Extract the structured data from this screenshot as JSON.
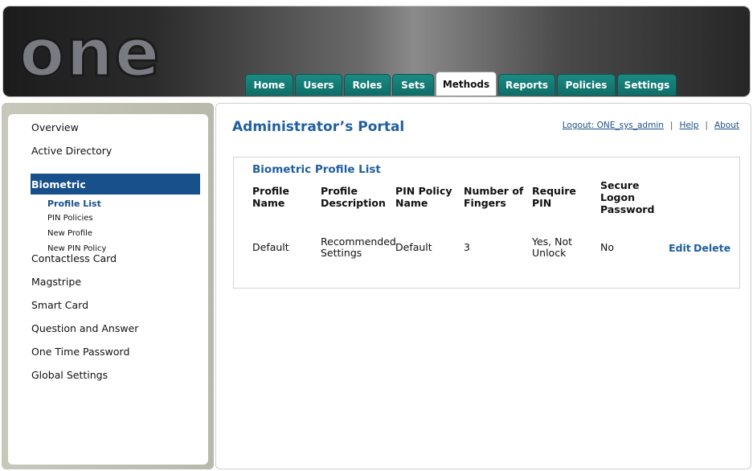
{
  "header": {
    "logo": "one",
    "tabs": [
      "Home",
      "Users",
      "Roles",
      "Sets",
      "Methods",
      "Reports",
      "Policies",
      "Settings"
    ],
    "active_tab": "Methods"
  },
  "sidebar": {
    "items": [
      "Overview",
      "Active Directory",
      "Biometric",
      "Contactless Card",
      "Magstripe",
      "Smart Card",
      "Question and Answer",
      "One Time Password",
      "Global Settings"
    ],
    "active_item": "Biometric",
    "sub_items": [
      "Profile List",
      "PIN Policies",
      "New Profile",
      "New PIN Policy"
    ],
    "active_sub_item": "Profile List"
  },
  "main": {
    "title": "Administrator’s Portal",
    "links": {
      "logout": "Logout: ONE_sys_admin",
      "help": "Help",
      "about": "About",
      "separator": "|"
    },
    "panel": {
      "title": "Biometric Profile List",
      "columns": [
        "Profile Name",
        "Profile Description",
        "PIN Policy Name",
        "Number of Fingers",
        "Require PIN",
        "Secure Logon Password"
      ],
      "rows": [
        {
          "profile_name": "Default",
          "description": "Recommended Settings",
          "pin_policy": "Default",
          "fingers": "3",
          "require_pin": "Yes, Not Unlock",
          "secure_logon": "No",
          "edit": "Edit",
          "delete": "Delete"
        }
      ]
    }
  },
  "colors": {
    "tab_green": "#137a74",
    "nav_active": "#17508a",
    "title_blue": "#1f5fa0"
  }
}
